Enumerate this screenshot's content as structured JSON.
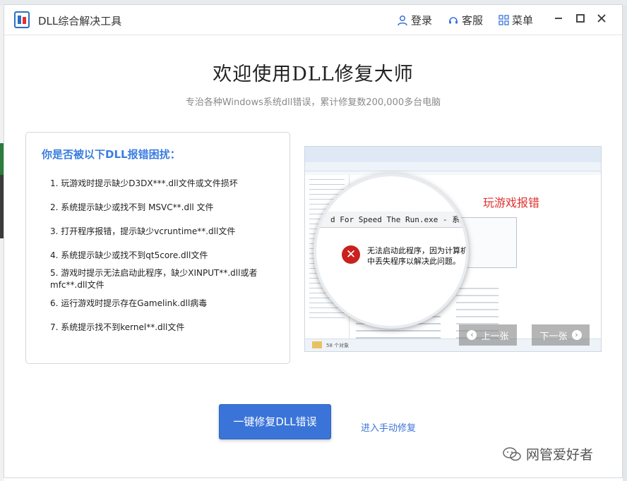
{
  "window": {
    "title": "DLL综合解决工具",
    "login_label": "登录",
    "service_label": "客服",
    "menu_label": "菜单"
  },
  "hero": {
    "heading": "欢迎使用DLL修复大师",
    "subtitle": "专治各种Windows系统dll错误，累计修复数200,000多台电脑"
  },
  "errors": {
    "question": "你是否被以下DLL报错困扰：",
    "items": [
      "1. 玩游戏时提示缺少D3DX***.dll文件或文件损坏",
      "2. 系统提示缺少或找不到 MSVC**.dll 文件",
      "3. 打开程序报错，提示缺少vcruntime**.dll文件",
      "4. 系统提示缺少或找不到qt5core.dll文件",
      "5. 游戏时提示无法启动此程序，缺少XINPUT**.dll或者mfc**.dll文件",
      "6. 运行游戏时提示存在Gamelink.dll病毒",
      "7. 系统提示找不到kernel**.dll文件"
    ]
  },
  "carousel": {
    "caption": "玩游戏报错",
    "dialog_title": "d For Speed The Run.exe - 系统错误",
    "dialog_message": "无法启动此程序，因为计算机中丢失程序以解决此问题。",
    "status_text": "58 个对象",
    "prev_label": "上一张",
    "next_label": "下一张"
  },
  "actions": {
    "fix_button": "一键修复DLL错误",
    "manual_link": "进入手动修复"
  },
  "watermark": "网管爱好者",
  "colors": {
    "accent": "#3a74d9",
    "heading_blue": "#3b7de0",
    "error_red": "#e0322f"
  }
}
